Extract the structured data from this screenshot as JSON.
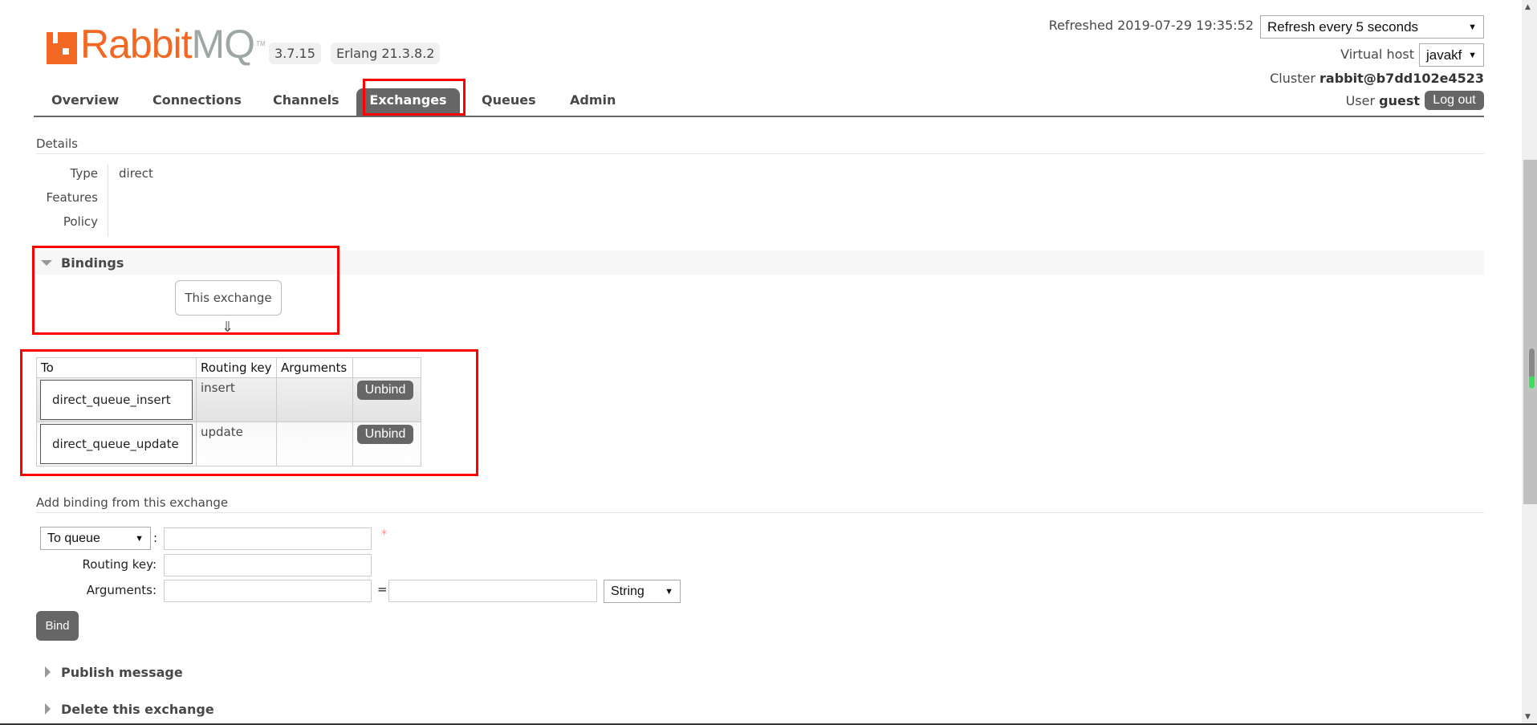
{
  "header": {
    "logo_text_rabbit": "Rabbit",
    "logo_text_mq": "MQ",
    "logo_tm": "TM",
    "version": "3.7.15",
    "erlang": "Erlang 21.3.8.2",
    "refreshed": "Refreshed 2019-07-29 19:35:52",
    "refresh_select": "Refresh every 5 seconds",
    "virtual_host_label": "Virtual host",
    "virtual_host_value": "javakf",
    "cluster_label": "Cluster",
    "cluster_value": "rabbit@b7dd102e4523",
    "user_label": "User",
    "user_value": "guest",
    "logout": "Log out"
  },
  "nav": {
    "tabs": [
      "Overview",
      "Connections",
      "Channels",
      "Exchanges",
      "Queues",
      "Admin"
    ],
    "active": "Exchanges"
  },
  "details": {
    "title": "Details",
    "rows": [
      {
        "label": "Type",
        "value": "direct"
      },
      {
        "label": "Features",
        "value": ""
      },
      {
        "label": "Policy",
        "value": ""
      }
    ]
  },
  "bindings": {
    "title": "Bindings",
    "this_exchange": "This exchange",
    "arrow": "⇓",
    "columns": [
      "To",
      "Routing key",
      "Arguments",
      ""
    ],
    "rows": [
      {
        "to": "direct_queue_insert",
        "routing_key": "insert",
        "arguments": "",
        "action": "Unbind"
      },
      {
        "to": "direct_queue_update",
        "routing_key": "update",
        "arguments": "",
        "action": "Unbind"
      }
    ]
  },
  "add_binding": {
    "title": "Add binding from this exchange",
    "dest_type": "To queue",
    "dest_value": "",
    "required_mark": "*",
    "routing_key_label": "Routing key:",
    "routing_key_value": "",
    "arguments_label": "Arguments:",
    "arg_key": "",
    "equals": "=",
    "arg_value": "",
    "arg_type": "String",
    "bind_button": "Bind"
  },
  "sections": {
    "publish": "Publish message",
    "delete": "Delete this exchange"
  },
  "colors": {
    "brand_orange": "#f26822",
    "tab_active": "#666666",
    "highlight_red": "#ff0000"
  }
}
